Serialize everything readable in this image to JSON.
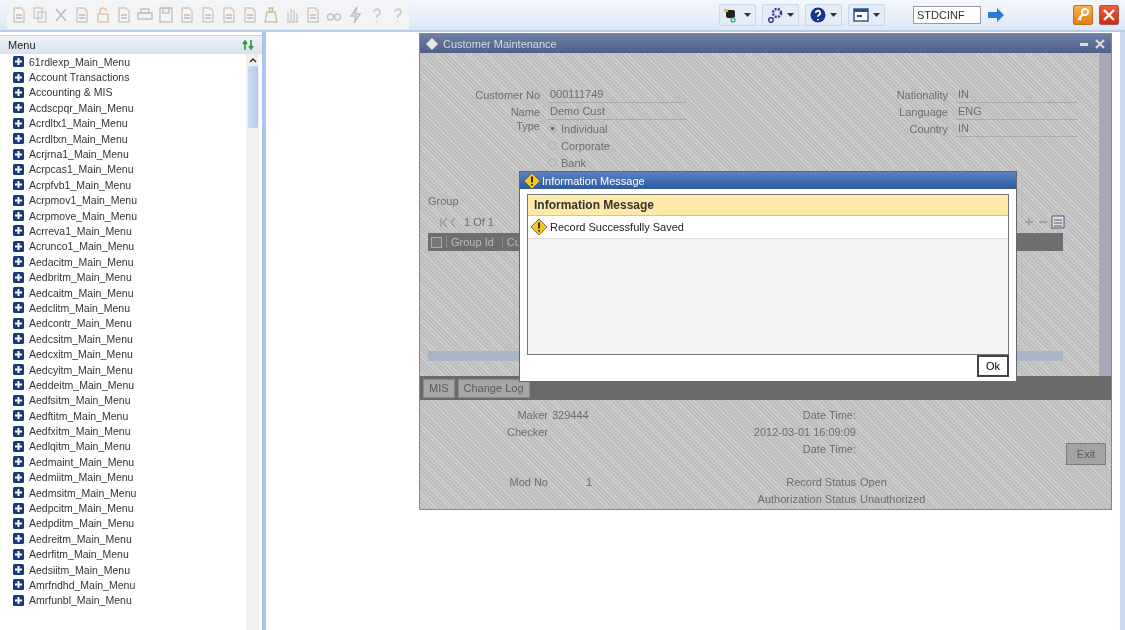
{
  "toolbar": {
    "function_id": "STDCINF"
  },
  "menu": {
    "title": "Menu",
    "items": [
      {
        "label": "61rdlexp_Main_Menu"
      },
      {
        "label": "Account Transactions"
      },
      {
        "label": "Accounting & MIS"
      },
      {
        "label": "Acdscpqr_Main_Menu"
      },
      {
        "label": "Acrdltx1_Main_Menu"
      },
      {
        "label": "Acrdltxn_Main_Menu"
      },
      {
        "label": "Acrjrna1_Main_Menu"
      },
      {
        "label": "Acrpcas1_Main_Menu"
      },
      {
        "label": "Acrpfvb1_Main_Menu"
      },
      {
        "label": "Acrpmov1_Main_Menu"
      },
      {
        "label": "Acrpmove_Main_Menu"
      },
      {
        "label": "Acrreva1_Main_Menu"
      },
      {
        "label": "Acrunco1_Main_Menu"
      },
      {
        "label": "Aedacitm_Main_Menu"
      },
      {
        "label": "Aedbritm_Main_Menu"
      },
      {
        "label": "Aedcaitm_Main_Menu"
      },
      {
        "label": "Aedclitm_Main_Menu"
      },
      {
        "label": "Aedcontr_Main_Menu"
      },
      {
        "label": "Aedcsitm_Main_Menu"
      },
      {
        "label": "Aedcxitm_Main_Menu"
      },
      {
        "label": "Aedcyitm_Main_Menu"
      },
      {
        "label": "Aeddeitm_Main_Menu"
      },
      {
        "label": "Aedfsitm_Main_Menu"
      },
      {
        "label": "Aedftitm_Main_Menu"
      },
      {
        "label": "Aedfxitm_Main_Menu"
      },
      {
        "label": "Aedlqitm_Main_Menu"
      },
      {
        "label": "Aedmaint_Main_Menu"
      },
      {
        "label": "Aedmiitm_Main_Menu"
      },
      {
        "label": "Aedmsitm_Main_Menu"
      },
      {
        "label": "Aedpcitm_Main_Menu"
      },
      {
        "label": "Aedpditm_Main_Menu"
      },
      {
        "label": "Aedreitm_Main_Menu"
      },
      {
        "label": "Aedrfitm_Main_Menu"
      },
      {
        "label": "Aedsiitm_Main_Menu"
      },
      {
        "label": "Amrfndhd_Main_Menu"
      },
      {
        "label": "Amrfunbl_Main_Menu"
      }
    ]
  },
  "window": {
    "title": "Customer Maintenance",
    "fields_left": [
      {
        "label": "Customer No",
        "value": "000111749"
      },
      {
        "label": "Name",
        "value": "Demo Cust"
      }
    ],
    "type": {
      "label": "Type",
      "options": [
        {
          "label": "Individual",
          "selected": true
        },
        {
          "label": "Corporate",
          "selected": false
        },
        {
          "label": "Bank",
          "selected": false
        }
      ]
    },
    "fields_right": [
      {
        "label": "Nationality",
        "value": "IN"
      },
      {
        "label": "Language",
        "value": "ENG"
      },
      {
        "label": "Country",
        "value": "IN"
      }
    ],
    "group": {
      "title": "Group",
      "pager": "1 Of 1",
      "select_all_checked": false,
      "columns": [
        "Group Id",
        "Cu"
      ]
    },
    "tabs": [
      "MIS",
      "Change Log"
    ],
    "audit": {
      "maker_label": "Maker",
      "maker": "329444",
      "date_time_label": "Date Time:",
      "checker_label": "Checker",
      "checker_date_time": "2012-03-01 16:09:09",
      "date_time_label_2": "Date Time:",
      "mod_no_label": "Mod No",
      "mod_no": "1",
      "record_status_label": "Record Status",
      "record_status": "Open",
      "auth_status_label": "Authorization Status",
      "auth_status": "Unauthorized"
    },
    "exit_button": "Exit"
  },
  "dialog": {
    "title": "Information Message",
    "header": "Information Message",
    "messages": [
      "Record Successfully Saved"
    ],
    "ok_button": "Ok"
  }
}
